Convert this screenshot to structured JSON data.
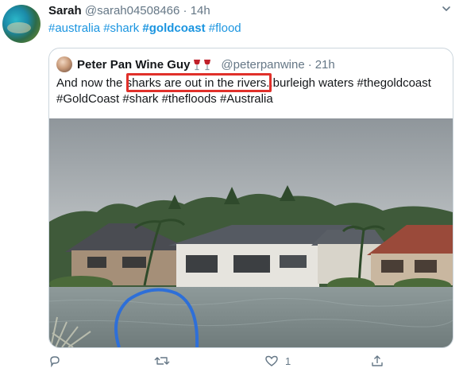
{
  "tweet": {
    "author_name": "Sarah",
    "author_handle": "@sarah04508466",
    "separator": "·",
    "time": "14h",
    "hashtags": [
      {
        "text": "#australia",
        "bold": false
      },
      {
        "text": "#shark",
        "bold": false
      },
      {
        "text": "#goldcoast",
        "bold": true
      },
      {
        "text": "#flood",
        "bold": false
      }
    ]
  },
  "quoted": {
    "author_name": "Peter Pan Wine Guy",
    "author_handle": "@peterpanwine",
    "separator": "·",
    "time": "21h",
    "text_before": "And now the ",
    "text_highlighted": "sharks are out in the rivers..",
    "text_after": "burleigh waters #thegoldcoast #GoldCoast #shark #thefloods #Australia",
    "name_emoji": "wine-glass-icon"
  },
  "actions": {
    "reply_count": "",
    "retweet_count": "",
    "like_count": "1"
  },
  "colors": {
    "link": "#1b95e0",
    "highlight_box": "#e0302a",
    "muted": "#657786",
    "border": "#ccd6dd"
  }
}
